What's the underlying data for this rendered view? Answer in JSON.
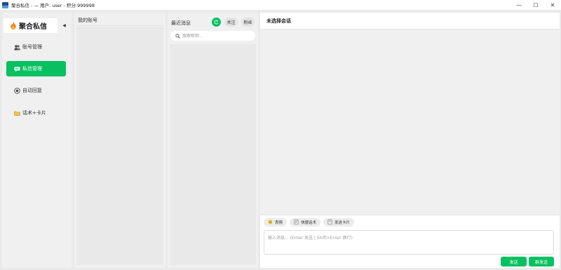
{
  "window": {
    "title": "聚合私信 - — 用户: user - 积分:999998",
    "minimize": "—",
    "maximize": "☐",
    "close": "✕"
  },
  "sidebar": {
    "brand": "聚合私信",
    "collapse": "◀",
    "items": [
      {
        "label": "账号管理",
        "icon": "users-icon",
        "active": false
      },
      {
        "label": "私信管理",
        "icon": "chat-bubble-icon",
        "active": true
      },
      {
        "label": "自动回复",
        "icon": "robot-icon",
        "active": false
      },
      {
        "label": "话术+卡片",
        "icon": "folder-icon",
        "active": false
      }
    ]
  },
  "accounts": {
    "title": "我的账号"
  },
  "recent": {
    "title": "最近消息",
    "refresh_icon": "refresh-icon",
    "follow": "关注",
    "fans": "粉丝",
    "search_placeholder": "搜索昵称..."
  },
  "chat": {
    "header": "未选择会话",
    "tools": {
      "emoji": "表情",
      "quick_reply": "快捷话术",
      "send_card": "发送卡片"
    },
    "input_placeholder": "输入消息... (Enter 发送 | Shift+Enter 换行)",
    "send": "发送",
    "broadcast": "群发送"
  },
  "colors": {
    "accent": "#07c160",
    "panel": "#f0f0f0",
    "background": "#eaeaea"
  }
}
